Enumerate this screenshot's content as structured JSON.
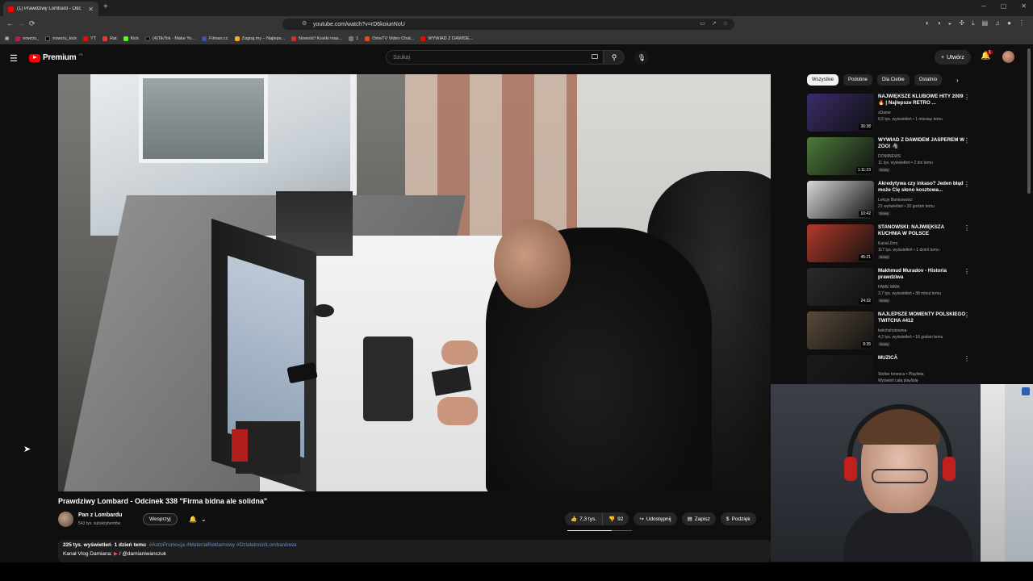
{
  "browser": {
    "tab_title": "(1) Prawdziwy Lombard - Odc",
    "tab_close": "✕",
    "new_tab": "+",
    "url": "youtube.com/watch?v=rD6koiunNoU",
    "window_controls": [
      "─",
      "▢",
      "✕"
    ],
    "bookmarks": [
      "nowciu_",
      "nowciu_kick",
      "YT",
      "Rat",
      "Kick",
      "(4)TikTok - Make Yo...",
      "Filman.cc",
      "Zagraj.my – Najleps...",
      "Nowość! Kostki mas...",
      "1",
      "OmeTV Video Chat...",
      "WYWIAD Z DAWIDE..."
    ]
  },
  "header": {
    "logo_text": "Premium",
    "logo_region": "PL",
    "search_placeholder": "Szukaj",
    "create_label": "Utwórz",
    "notification_count": "1"
  },
  "video": {
    "title": "Prawdziwy Lombard - Odcinek 338 \"Firma bidna ale solidna\"",
    "channel": "Pan z Lombardu",
    "subscribers": "543 tys. subskrybentów",
    "join_label": "Wesprzyj",
    "likes": "7,3 tys.",
    "dislikes": "92",
    "share_label": "Udostępnij",
    "save_label": "Zapisz",
    "thanks_label": "Podzięk",
    "like_ratio": 0.69,
    "desc_views": "225 tys. wyświetleń",
    "desc_date": "1 dzień temu",
    "desc_tags": "#AutoPromocja #MateriałReklamowy #DziałalnośćLombardowa",
    "desc_line2_prefix": "Kanał Vlog Damiana:",
    "desc_line2_handle": "/ @damianiwanczuk"
  },
  "chips": [
    "Wszystkie",
    "Podobne",
    "Dla Ciebie",
    "Ostatnio"
  ],
  "recommendations": [
    {
      "title": "NAJWIĘKSZE KLUBOWE HITY 2009 🔥 | Najlepsze RETRO ...",
      "channel": "xDame",
      "meta": "6,5 tys. wyświetleń • 1 miesiąc temu",
      "duration": "36:38",
      "new": "",
      "thumb_color": "#3a2a6a"
    },
    {
      "title": "WYWIAD Z DAWIDEM JASPEREM W ZOO! 🦓",
      "channel": "DOMINEWS",
      "meta": "11 tys. wyświetleń • 2 dni temu",
      "duration": "1:11:23",
      "new": "Nowy",
      "thumb_color": "#4c7a3a"
    },
    {
      "title": "Akredytywa czy inkaso? Jeden błąd może Cię słono kosztowa...",
      "channel": "Lekcje Bankowości",
      "meta": "21 wyświetleń • 20 godzin temu",
      "duration": "10:42",
      "new": "Nowy",
      "thumb_color": "#d8d8d8"
    },
    {
      "title": "STANOWSKI: NAJWIĘKSZA KUCHNIA W POLSCE",
      "channel": "Kanał Zero",
      "meta": "117 tys. wyświetleń • 1 dzień temu",
      "duration": "45:21",
      "new": "Nowy",
      "thumb_color": "#b33a2a"
    },
    {
      "title": "Makhmud Muradov - Historia prawdziwa",
      "channel": "FAME MMA",
      "meta": "3,7 tys. wyświetleń • 38 minut temu",
      "duration": "24:32",
      "new": "Nowy",
      "thumb_color": "#2a2a2a"
    },
    {
      "title": "NAJLEPSZE MOMENTY POLSKIEGO TWITCHA #412",
      "channel": "twitchshotownia",
      "meta": "4,2 tys. wyświetleń • 16 godzin temu",
      "duration": "8:35",
      "new": "Nowy",
      "thumb_color": "#5a4a3a"
    },
    {
      "title": "MUZICĂ",
      "channel": "Stefan Ionescu • Playlista",
      "meta": "Wyświetl całą playlistę",
      "duration": "",
      "new": "",
      "thumb_color": "#1a1a1a"
    }
  ]
}
